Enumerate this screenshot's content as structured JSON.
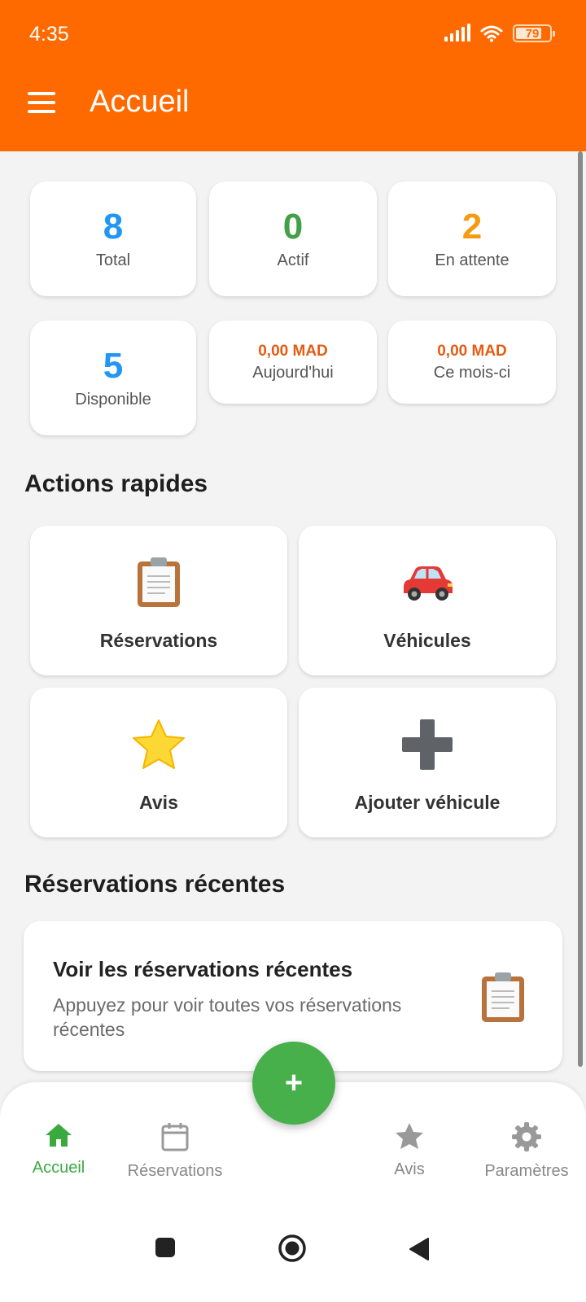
{
  "status_bar": {
    "time": "4:35",
    "battery": "79",
    "battery_level": 0.79
  },
  "app_bar": {
    "title": "Accueil"
  },
  "stats": {
    "total": {
      "value": "8",
      "label": "Total",
      "color": "#2196f3"
    },
    "actif": {
      "value": "0",
      "label": "Actif",
      "color": "#43a047"
    },
    "attente": {
      "value": "2",
      "label": "En attente",
      "color": "#f39c12"
    },
    "disponible": {
      "value": "5",
      "label": "Disponible",
      "color": "#2196f3"
    },
    "aujourdhui": {
      "value": "0,00 MAD",
      "label": "Aujourd'hui"
    },
    "mois": {
      "value": "0,00 MAD",
      "label": "Ce mois-ci"
    }
  },
  "quick_actions": {
    "title": "Actions rapides",
    "reservations": {
      "label": "Réservations",
      "icon": "clipboard-icon"
    },
    "vehicules": {
      "label": "Véhicules",
      "icon": "car-icon"
    },
    "avis": {
      "label": "Avis",
      "icon": "star-icon"
    },
    "ajouter": {
      "label": "Ajouter véhicule",
      "icon": "plus-icon"
    }
  },
  "recent": {
    "title": "Réservations récentes",
    "card_title": "Voir les réservations récentes",
    "card_subtitle": "Appuyez pour voir toutes vos réservations récentes",
    "icon": "clipboard-icon"
  },
  "fab": {
    "label": "+"
  },
  "bottom_nav": {
    "accueil": "Accueil",
    "reservations": "Réservations",
    "avis": "Avis",
    "parametres": "Paramètres",
    "active_color": "#3aaa3f"
  },
  "colors": {
    "primary": "#ff6a00",
    "fab": "#47b04b"
  }
}
